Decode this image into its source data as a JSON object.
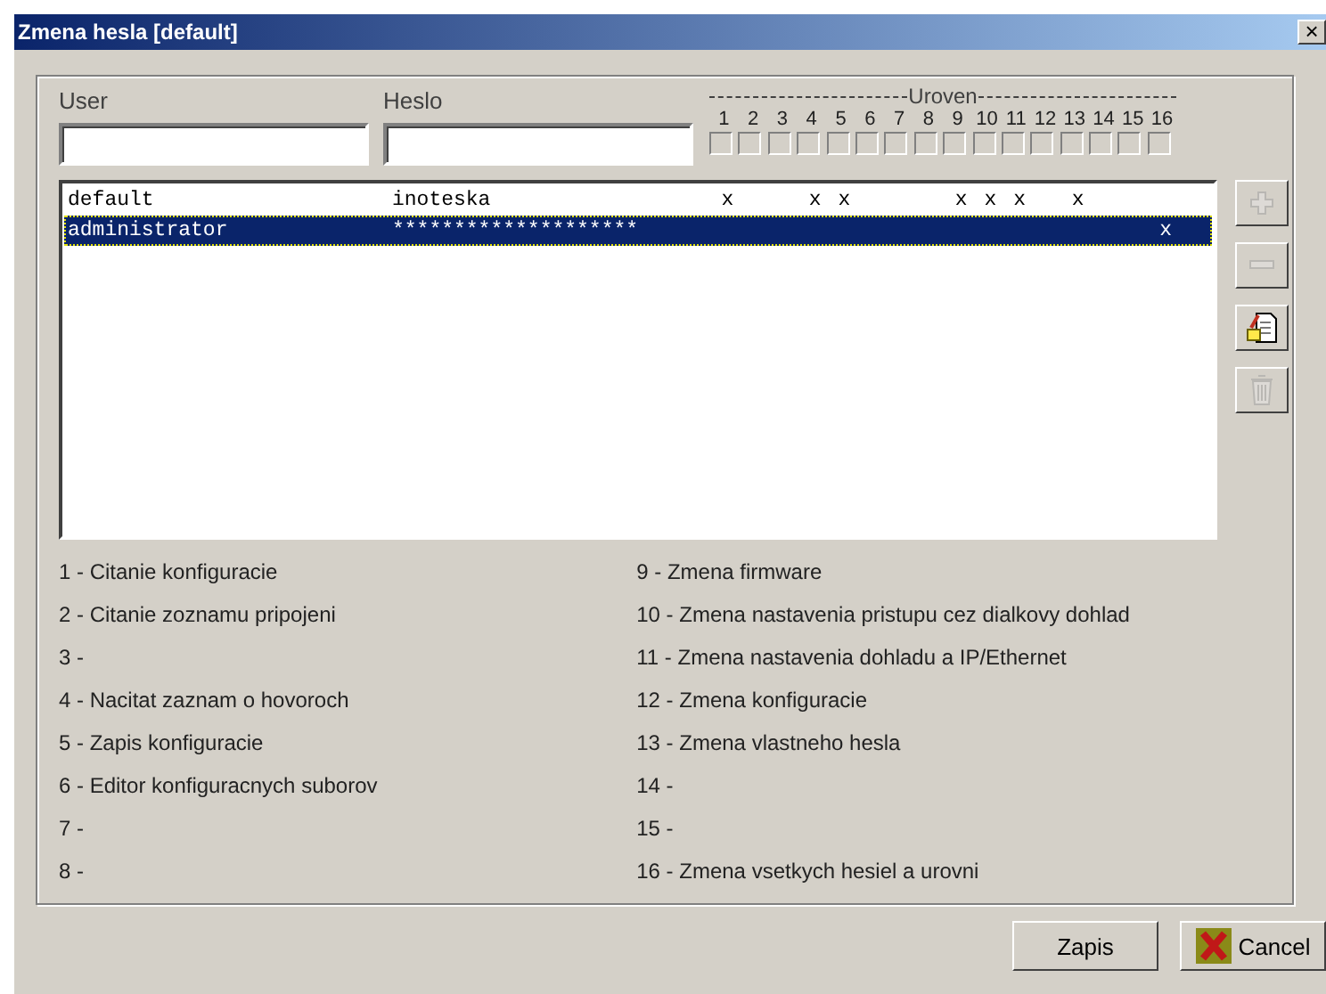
{
  "window": {
    "title": "Zmena hesla [default]",
    "close": "×"
  },
  "form": {
    "user_label": "User",
    "password_label": "Heslo",
    "levels_label": "Uroven",
    "levels": [
      {
        "label": "1",
        "checked": false
      },
      {
        "label": "2",
        "checked": false
      },
      {
        "label": "3",
        "checked": false
      },
      {
        "label": "4",
        "checked": false
      },
      {
        "label": "5",
        "checked": false
      },
      {
        "label": "6",
        "checked": false
      },
      {
        "label": "7",
        "checked": false
      },
      {
        "label": "8",
        "checked": false
      },
      {
        "label": "9",
        "checked": false
      },
      {
        "label": "10",
        "checked": false
      },
      {
        "label": "11",
        "checked": false
      },
      {
        "label": "12",
        "checked": false
      },
      {
        "label": "13",
        "checked": false
      },
      {
        "label": "14",
        "checked": false
      },
      {
        "label": "15",
        "checked": false
      },
      {
        "label": "16",
        "checked": false
      }
    ]
  },
  "users": [
    {
      "user": "default",
      "password": "inoteska",
      "selected": false,
      "level_cells": [
        "x",
        null,
        null,
        "x",
        "x",
        null,
        null,
        null,
        "x",
        "x",
        "x",
        null,
        "x",
        null,
        null,
        null
      ]
    },
    {
      "user": "administrator",
      "password": "********************",
      "selected": true,
      "level_cells": [
        null,
        null,
        null,
        null,
        null,
        null,
        null,
        null,
        null,
        null,
        null,
        null,
        null,
        null,
        null,
        "x"
      ]
    }
  ],
  "side_buttons": [
    {
      "kind": "add",
      "disabled": true
    },
    {
      "kind": "remove",
      "disabled": true
    },
    {
      "kind": "edit",
      "disabled": false
    },
    {
      "kind": "delete",
      "disabled": true
    }
  ],
  "legend_left": [
    "1 - Citanie konfiguracie",
    "2 - Citanie zoznamu pripojeni",
    "3 -",
    "4 - Nacitat zaznam o hovoroch",
    "5 - Zapis konfiguracie",
    "6 - Editor konfiguracnych suborov",
    "7 -",
    "8 -"
  ],
  "legend_right": [
    "9 - Zmena firmware",
    "10 - Zmena nastavenia pristupu cez dialkovy dohlad",
    "11 - Zmena nastavenia dohladu a IP/Ethernet",
    "12 - Zmena konfiguracie",
    "13 - Zmena vlastneho hesla",
    "14 -",
    "15 -",
    "16 - Zmena vsetkych hesiel a urovni"
  ],
  "buttons": [
    {
      "label": "Zapis",
      "kind": "plain"
    },
    {
      "label": "Cancel",
      "kind": "cancel"
    }
  ]
}
